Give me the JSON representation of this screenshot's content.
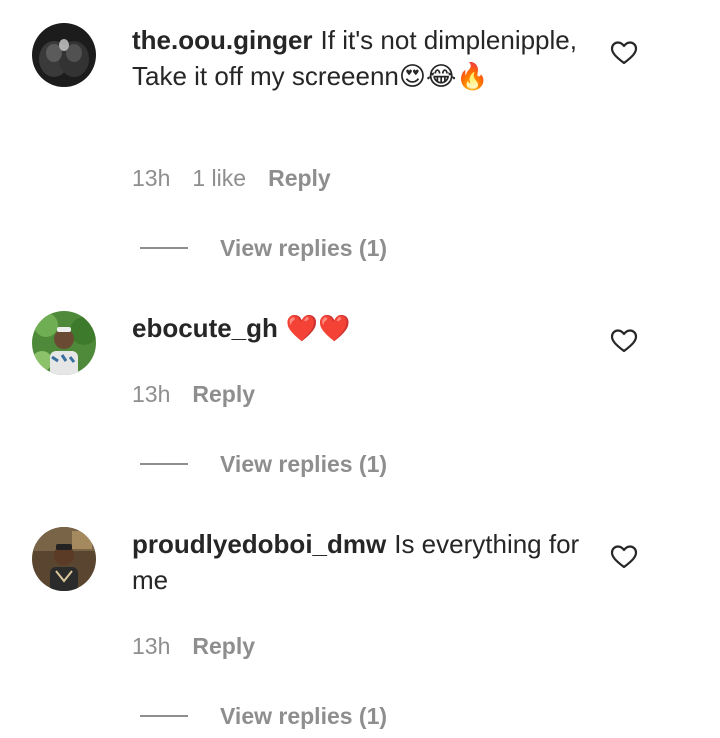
{
  "comments": [
    {
      "username": "the.oou.ginger",
      "text": "If it's not dimplenipple, Take it off my screeenn😍😂🔥",
      "time": "13h",
      "likes": "1 like",
      "reply_label": "Reply",
      "view_replies": "View replies (1)",
      "avatar_icon": "dark-abstract-avatar"
    },
    {
      "username": "ebocute_gh",
      "text": "❤️❤️",
      "time": "13h",
      "reply_label": "Reply",
      "view_replies": "View replies (1)",
      "avatar_icon": "person-photo-avatar"
    },
    {
      "username": "proudlyedoboi_dmw",
      "text": "Is everything for me",
      "time": "13h",
      "reply_label": "Reply",
      "view_replies": "View replies (1)",
      "avatar_icon": "person-photo-avatar"
    }
  ],
  "colors": {
    "text": "#262626",
    "secondary": "#8e8e8e",
    "heart_stroke": "#262626",
    "red_heart": "#e0245e"
  }
}
